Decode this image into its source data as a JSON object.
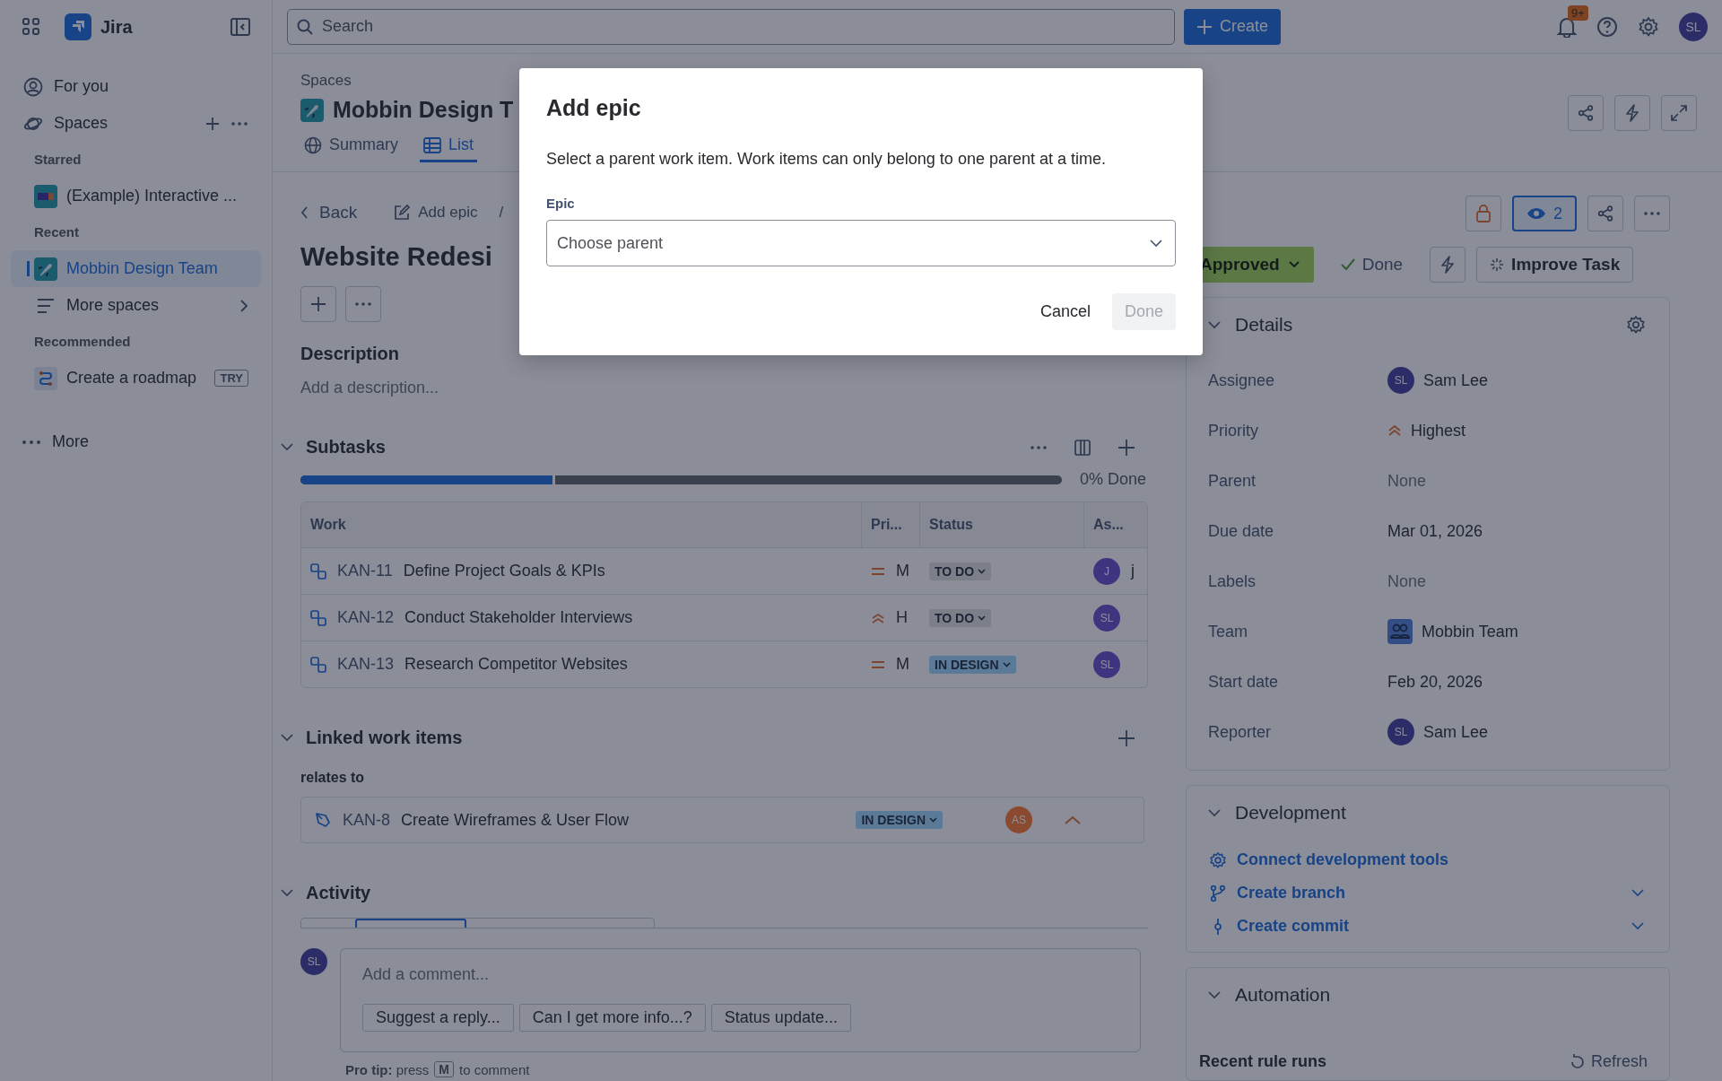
{
  "topbar": {
    "app_name": "Jira",
    "search": {
      "placeholder": "Search"
    },
    "create_label": "Create",
    "notification_badge": "9+",
    "avatar": "SL"
  },
  "sidebar": {
    "items": [
      {
        "kind": "nav",
        "label": "For you",
        "selected": false
      },
      {
        "kind": "group",
        "label": "Spaces",
        "selected": false
      },
      {
        "kind": "heading",
        "label": "Starred"
      },
      {
        "kind": "space",
        "label": "(Example) Interactive ...",
        "selected": false
      },
      {
        "kind": "heading",
        "label": "Recent"
      },
      {
        "kind": "space",
        "label": "Mobbin Design Team",
        "selected": true
      },
      {
        "kind": "nav",
        "label": "More spaces",
        "selected": false,
        "chevron": true
      },
      {
        "kind": "heading",
        "label": "Recommended"
      },
      {
        "kind": "space",
        "label": "Create a roadmap",
        "badge": "TRY",
        "selected": false
      },
      {
        "kind": "more",
        "label": "More"
      }
    ]
  },
  "header": {
    "breadcrumb": "Spaces",
    "space_title": "Mobbin Design T",
    "tabs": [
      {
        "label": "Summary",
        "selected": false
      },
      {
        "label": "List",
        "selected": true
      }
    ]
  },
  "issue": {
    "back": "Back",
    "add_epic": "Add epic",
    "separator": "/",
    "title": "Website Redesi",
    "description": {
      "title": "Description",
      "placeholder": "Add a description..."
    },
    "subtasks": {
      "title": "Subtasks",
      "level": 0.334,
      "progress_text": "0% Done",
      "columns": [
        "Work",
        "Pri...",
        "Status",
        "As..."
      ],
      "rows": [
        {
          "key": "KAN-11",
          "summary": "Define Project Goals & KPIs",
          "priority": {
            "kind": "medium",
            "label": "M"
          },
          "status": {
            "label": "TO DO",
            "color": "#7d7f88"
          },
          "assignee": {
            "initials": "J",
            "color": "#3d3580",
            "name": "j"
          }
        },
        {
          "key": "KAN-12",
          "summary": "Conduct Stakeholder Interviews",
          "priority": {
            "kind": "high",
            "label": "H"
          },
          "status": {
            "label": "TO DO",
            "color": "#7d7f88"
          },
          "assignee": {
            "initials": "SL",
            "color": "#3d3580"
          }
        },
        {
          "key": "KAN-13",
          "summary": "Research Competitor Websites",
          "priority": {
            "kind": "medium",
            "label": "M"
          },
          "status": {
            "label": "IN DESIGN",
            "color": "#5a7a98"
          },
          "assignee": {
            "initials": "SL",
            "color": "#3d3580"
          }
        }
      ]
    },
    "linked": {
      "title": "Linked work items",
      "relation": "relates to",
      "items": [
        {
          "key": "KAN-8",
          "summary": "Create Wireframes & User Flow",
          "status": {
            "label": "IN DESIGN",
            "color": "#5a7a98"
          },
          "assignee": {
            "initials": "AS",
            "color": "#8a4a30"
          }
        }
      ]
    },
    "activity": {
      "title": "Activity",
      "avatar": "SL",
      "comment_placeholder": "Add a comment...",
      "suggestions": [
        "Suggest a reply...",
        "Can I get more info...?",
        "Status update..."
      ],
      "pro_tip": "**Pro tip:** press",
      "pro_tip_key": "M",
      "pro_tip_end": "to comment"
    }
  },
  "right_panel": {
    "watchers": "2",
    "status": "Approved",
    "done": "Done",
    "improve": "Improve Task",
    "details": {
      "title": "Details",
      "fields": [
        {
          "label": "Assignee",
          "kind": "avatar",
          "avatar": "SL",
          "value": "Sam Lee"
        },
        {
          "label": "Priority",
          "kind": "priority",
          "value": "Highest"
        },
        {
          "label": "Parent",
          "kind": "empty",
          "value": "None"
        },
        {
          "label": "Due date",
          "kind": "text",
          "value": "Mar 01, 2026"
        },
        {
          "label": "Labels",
          "kind": "empty",
          "value": "None"
        },
        {
          "label": "Team",
          "kind": "team",
          "value": "Mobbin Team"
        },
        {
          "label": "Start date",
          "kind": "text",
          "value": "Feb 20, 2026"
        },
        {
          "label": "Reporter",
          "kind": "avatar",
          "avatar": "SL",
          "value": "Sam Lee"
        }
      ]
    },
    "development": {
      "title": "Development",
      "links": [
        {
          "label": "Connect development tools",
          "expandable": false
        },
        {
          "label": "Create branch",
          "expandable": true
        },
        {
          "label": "Create commit",
          "expandable": true
        }
      ]
    },
    "automation": {
      "title": "Automation",
      "recent_rule_runs": "Recent rule runs",
      "refresh": "Refresh"
    }
  },
  "modal": {
    "title": "Add epic",
    "description": "Select a parent work item. Work items can only belong to one parent at a time.",
    "field_label": "Epic",
    "placeholder": "Choose parent",
    "cancel": "Cancel",
    "done": "Done",
    "done_disabled": true
  }
}
